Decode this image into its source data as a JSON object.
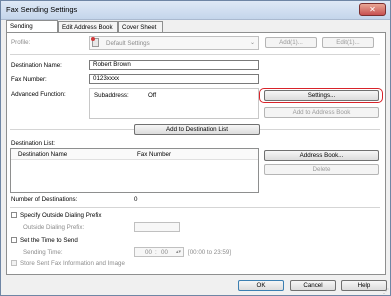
{
  "window": {
    "title": "Fax Sending Settings",
    "close_glyph": "✕"
  },
  "tabs": [
    {
      "label": "Sending Settings",
      "active": true
    },
    {
      "label": "Edit Address Book"
    },
    {
      "label": "Cover Sheet"
    }
  ],
  "profile": {
    "label": "Profile:",
    "value": "Default Settings",
    "add_label": "Add(1)...",
    "edit_label": "Edit(1)..."
  },
  "destination": {
    "name_label": "Destination Name:",
    "name_value": "Robert Brown",
    "number_label": "Fax Number:",
    "number_value": "0123xxxx"
  },
  "advanced": {
    "label": "Advanced Function:",
    "subaddress_label": "Subaddress:",
    "subaddress_value": "Off",
    "settings_label": "Settings...",
    "add_to_book_label": "Add to Address Book"
  },
  "add_to_list_label": "Add to Destination List",
  "dest_list": {
    "label": "Destination List:",
    "col_name": "Destination Name",
    "col_fax": "Fax Number",
    "address_book_label": "Address Book...",
    "delete_label": "Delete"
  },
  "count": {
    "label": "Number of Destinations:",
    "value": "0"
  },
  "dialing": {
    "checkbox_label": "Specify Outside Dialing Prefix",
    "prefix_label": "Outside Dialing Prefix:"
  },
  "time": {
    "checkbox_label": "Set the Time to Send",
    "sending_label": "Sending Time:",
    "hour": "00",
    "minute": "00",
    "range": "[00:00 to 23:59]"
  },
  "store": {
    "label": "Store Sent Fax Information and Image"
  },
  "footer": {
    "ok": "OK",
    "cancel": "Cancel",
    "help": "Help"
  },
  "colors": {
    "highlight": "#d8232a"
  }
}
